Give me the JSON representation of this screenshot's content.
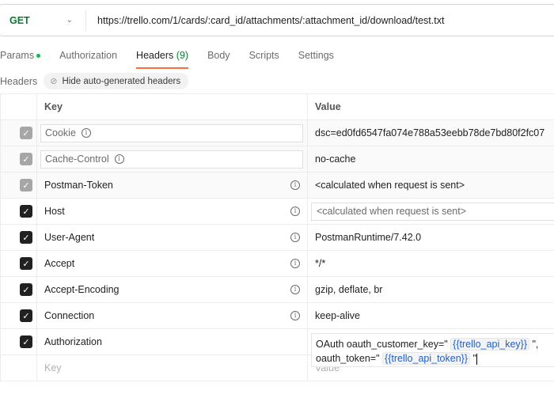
{
  "request": {
    "method": "GET",
    "url": "https://trello.com/1/cards/:card_id/attachments/:attachment_id/download/test.txt"
  },
  "tabs": [
    {
      "label": "Params"
    },
    {
      "label": "Authorization"
    },
    {
      "label": "Headers",
      "count": "(9)"
    },
    {
      "label": "Body"
    },
    {
      "label": "Scripts"
    },
    {
      "label": "Settings"
    }
  ],
  "headers_section": {
    "label": "Headers",
    "toggle_label": "Hide auto-generated headers"
  },
  "table": {
    "columns": [
      "Key",
      "Value"
    ],
    "rows": [
      {
        "key": "Cookie",
        "value": "dsc=ed0fd6547fa074e788a53eebb78de7bd80f2fc07",
        "checked": true
      },
      {
        "key": "Cache-Control",
        "value": "no-cache",
        "checked": true
      },
      {
        "key": "Postman-Token",
        "value": "<calculated when request is sent>",
        "checked": true
      },
      {
        "key": "Host",
        "value": "<calculated when request is sent>",
        "checked": true
      },
      {
        "key": "User-Agent",
        "value": "PostmanRuntime/7.42.0",
        "checked": true
      },
      {
        "key": "Accept",
        "value": "*/*",
        "checked": true
      },
      {
        "key": "Accept-Encoding",
        "value": "gzip, deflate, br",
        "checked": true
      },
      {
        "key": "Connection",
        "value": "keep-alive",
        "checked": true
      },
      {
        "key": "Authorization",
        "checked": true
      }
    ],
    "placeholder": {
      "key": "Key",
      "value": "Value"
    }
  },
  "auth_value": {
    "p1": "OAuth oauth_customer_key=\"",
    "v1": "{{trello_api_key}}",
    "p2": "\",",
    "p3": "oauth_token=\"",
    "v2": "{{trello_api_token}}",
    "p4": "\""
  }
}
